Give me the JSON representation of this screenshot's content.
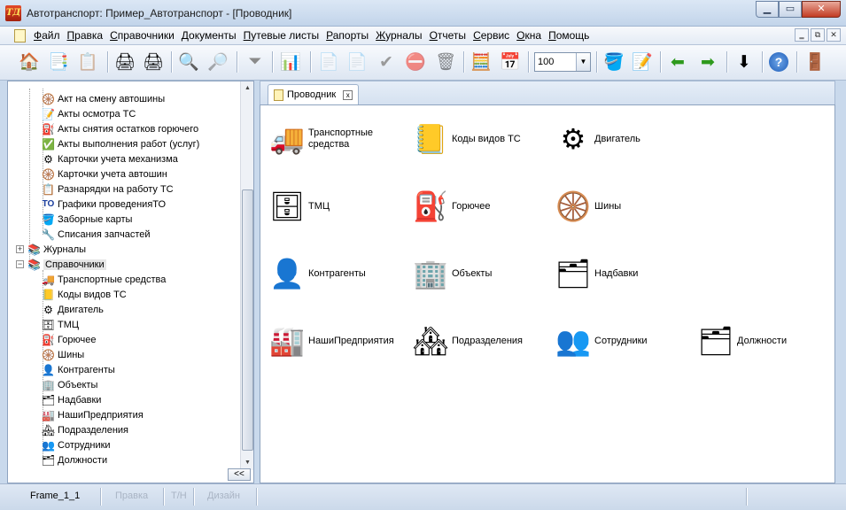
{
  "window": {
    "logo": "ТД",
    "title": "Автотранспорт: Пример_Автотранспорт - [Проводник]",
    "controls": {
      "minimize": "▁",
      "maximize": "▭",
      "close": "✕"
    }
  },
  "menu": {
    "items": [
      "Файл",
      "Правка",
      "Справочники",
      "Документы",
      "Путевые листы",
      "Рапорты",
      "Журналы",
      "Отчеты",
      "Сервис",
      "Окна",
      "Помощь"
    ],
    "mdi": {
      "minimize": "‗",
      "restore": "⧉",
      "close": "✕"
    }
  },
  "toolbar": {
    "zoom_value": "100",
    "zoom_drop": "▼",
    "icons": {
      "home": "🏠",
      "copy_docs": "📑",
      "paste": "📋",
      "print_preview": "🖨",
      "print": "🖨",
      "search": "🔍",
      "zoom": "🔎",
      "filter": "⏷",
      "chart": "📊",
      "new_doc": "📄",
      "copy_doc": "📄",
      "approve": "✔",
      "reject": "⛔",
      "delete_doc": "🗑",
      "calculator": "🧮",
      "calendar": "📅",
      "stack": "🪣",
      "notes": "📝",
      "back": "⬅",
      "forward": "➡",
      "download": "⬇",
      "help": "?",
      "exit": "🚪"
    }
  },
  "tree": {
    "close": "✕",
    "collapse_label": "<<",
    "documents_children": [
      {
        "label": "Акт на смену автошины",
        "icon": "🛞"
      },
      {
        "label": "Акты осмотра ТС",
        "icon": "📝"
      },
      {
        "label": "Акты снятия остатков горючего",
        "icon": "⛽"
      },
      {
        "label": "Акты выполнения работ (услуг)",
        "icon": "✅"
      },
      {
        "label": "Карточки учета механизма",
        "icon": "⚙"
      },
      {
        "label": "Карточки учета автошин",
        "icon": "🛞"
      },
      {
        "label": "Разнарядки на работу ТС",
        "icon": "📋"
      },
      {
        "label": "Графики проведенияТО",
        "icon": "ТО"
      },
      {
        "label": "Заборные карты",
        "icon": "🪣"
      },
      {
        "label": "Списания запчастей",
        "icon": "🔧"
      }
    ],
    "journals": {
      "label": "Журналы",
      "icon": "📚"
    },
    "references": {
      "label": "Справочники",
      "icon": "📚"
    },
    "references_children": [
      {
        "label": "Транспортные средства",
        "icon": "🚚"
      },
      {
        "label": "Коды видов ТС",
        "icon": "📒"
      },
      {
        "label": "Двигатель",
        "icon": "⚙"
      },
      {
        "label": "ТМЦ",
        "icon": "🗄"
      },
      {
        "label": "Горючее",
        "icon": "⛽"
      },
      {
        "label": "Шины",
        "icon": "🛞"
      },
      {
        "label": "Контрагенты",
        "icon": "👤"
      },
      {
        "label": "Объекты",
        "icon": "🏢"
      },
      {
        "label": "Надбавки",
        "icon": "🗂"
      },
      {
        "label": "НашиПредприятия",
        "icon": "🏭"
      },
      {
        "label": "Подразделения",
        "icon": "🏘"
      },
      {
        "label": "Сотрудники",
        "icon": "👥"
      },
      {
        "label": "Должности",
        "icon": "🗂"
      }
    ]
  },
  "tab": {
    "label": "Проводник",
    "close": "x"
  },
  "tiles": [
    {
      "label": "Транспортные средства",
      "icon": "🚚"
    },
    {
      "label": "Коды видов ТС",
      "icon": "📒"
    },
    {
      "label": "Двигатель",
      "icon": "⚙"
    },
    {
      "label": "ТМЦ",
      "icon": "🗄"
    },
    {
      "label": "Горючее",
      "icon": "⛽"
    },
    {
      "label": "Шины",
      "icon": "🛞"
    },
    {
      "label": "Контрагенты",
      "icon": "👤"
    },
    {
      "label": "Объекты",
      "icon": "🏢"
    },
    {
      "label": "Надбавки",
      "icon": "🗂"
    },
    {
      "label": "НашиПредприятия",
      "icon": "🏭"
    },
    {
      "label": "Подразделения",
      "icon": "🏘"
    },
    {
      "label": "Сотрудники",
      "icon": "👥"
    },
    {
      "label": "Должности",
      "icon": "🗂"
    }
  ],
  "status": {
    "frame": "Frame_1_1",
    "edit": "Правка",
    "tn": "Т/Н",
    "design": "Дизайн"
  }
}
